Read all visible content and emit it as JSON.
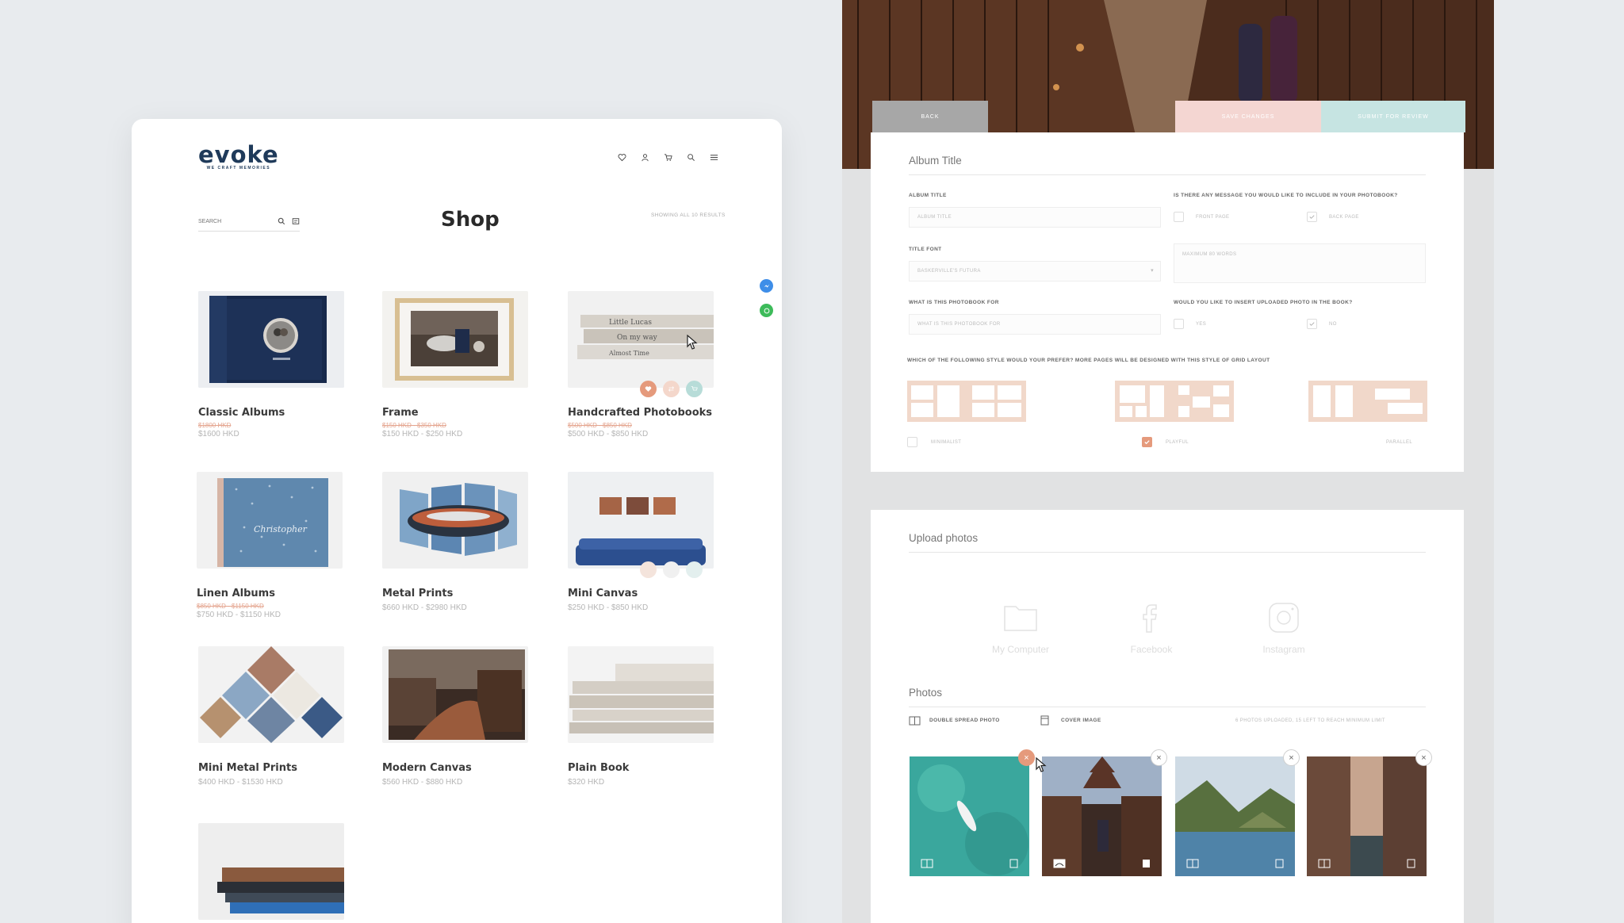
{
  "shop": {
    "logo_word": "evoke",
    "logo_tagline": "WE CRAFT MEMORIES",
    "search_placeholder": "SEARCH",
    "title": "Shop",
    "results_text": "SHOWING ALL 10 RESULTS",
    "header_icons": [
      "heart-icon",
      "user-icon",
      "cart-icon",
      "search-icon",
      "menu-icon"
    ],
    "products": [
      {
        "name": "Classic Albums",
        "old_price": "$1800 HKD",
        "price": "$1600 HKD"
      },
      {
        "name": "Frame",
        "old_price": "$150 HKD - $350 HKD",
        "price": "$150 HKD - $250 HKD"
      },
      {
        "name": "Handcrafted Photobooks",
        "old_price": "$500 HKD - $850 HKD",
        "price": "$500 HKD - $850 HKD"
      },
      {
        "name": "Linen Albums",
        "old_price": "$850 HKD - $1150 HKD",
        "price": "$750 HKD - $1150 HKD"
      },
      {
        "name": "Metal Prints",
        "old_price": "",
        "price": "$660 HKD - $2980 HKD"
      },
      {
        "name": "Mini Canvas",
        "old_price": "",
        "price": "$250 HKD - $850 HKD"
      },
      {
        "name": "Mini Metal Prints",
        "old_price": "",
        "price": "$400 HKD - $1530 HKD"
      },
      {
        "name": "Modern Canvas",
        "old_price": "",
        "price": "$560 HKD - $880 HKD"
      },
      {
        "name": "Plain Book",
        "old_price": "",
        "price": "$320 HKD"
      }
    ],
    "book_spines": [
      "Little Lucas",
      "On my way",
      "Almost Time"
    ],
    "float_icons": [
      "messenger-icon",
      "whatsapp-icon"
    ]
  },
  "editor": {
    "buttons": {
      "back": "BACK",
      "save": "SAVE CHANGES",
      "submit": "SUBMIT FOR REVIEW"
    },
    "album_section_title": "Album Title",
    "fields": {
      "album_title_label": "ALBUM TITLE",
      "album_title_placeholder": "ALBUM TITLE",
      "message_question": "IS THERE ANY MESSAGE YOU WOULD LIKE TO INCLUDE IN YOUR PHOTOBOOK?",
      "front_page": "FRONT PAGE",
      "back_page": "BACK PAGE",
      "title_font_label": "TITLE FONT",
      "title_font_value": "BASKERVILLE'S FUTURA",
      "message_placeholder": "MAXIMUM 80 WORDS",
      "for_label": "WHAT IS THIS PHOTOBOOK FOR",
      "for_placeholder": "WHAT IS THIS PHOTOBOOK FOR",
      "insert_question": "WOULD YOU LIKE TO INSERT UPLOADED PHOTO IN THE BOOK?",
      "yes": "YES",
      "no": "NO",
      "style_question": "WHICH OF THE FOLLOWING STYLE WOULD YOUR PREFER? MORE PAGES WILL BE DESIGNED WITH THIS STYLE OF GRID LAYOUT"
    },
    "styles": [
      "MINIMALIST",
      "PLAYFUL",
      "PARALLEL"
    ],
    "upload_title": "Upload photos",
    "sources": [
      "My Computer",
      "Facebook",
      "Instagram"
    ],
    "photos_title": "Photos",
    "double_spread": "DOUBLE SPREAD PHOTO",
    "cover_image": "COVER IMAGE",
    "upload_status": "6 PHOTOS UPLOADED, 15 LEFT TO REACH MINIMUM LIMIT",
    "accent_color": "#e59a7c",
    "teal_color": "#b7dcd8"
  }
}
